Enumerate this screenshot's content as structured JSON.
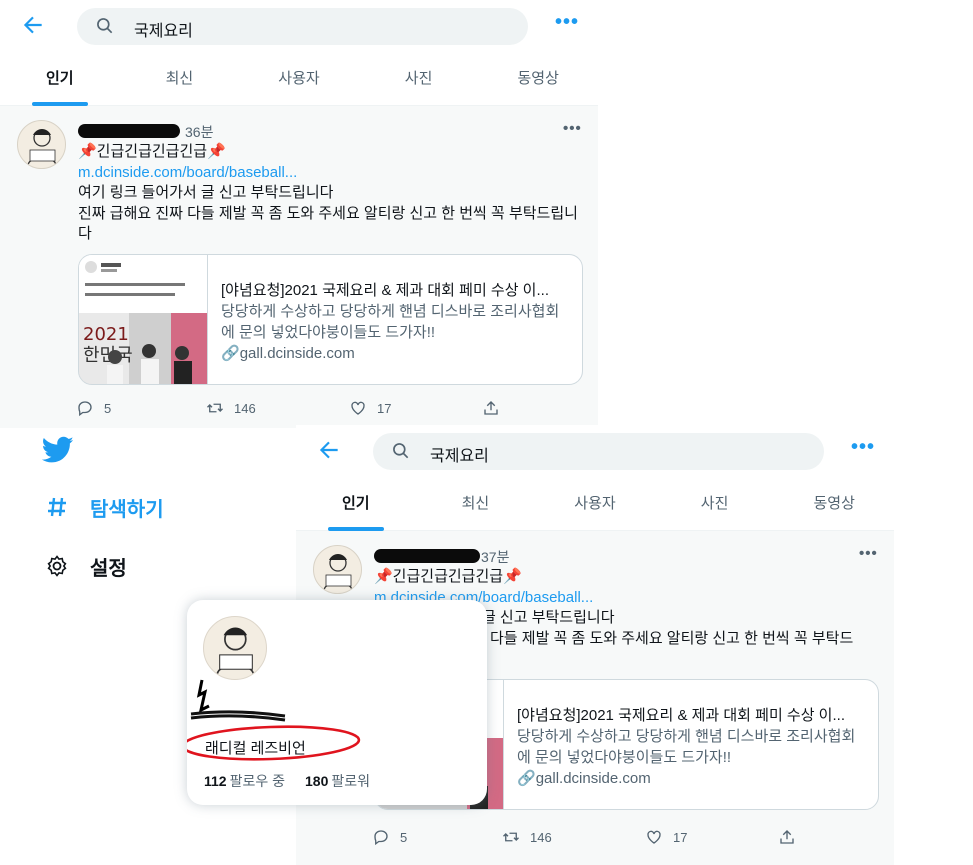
{
  "search": {
    "query": "국제요리"
  },
  "tabs": [
    "인기",
    "최신",
    "사용자",
    "사진",
    "동영상"
  ],
  "tweet_top": {
    "time": "36분",
    "title": "📌긴급긴급긴급긴급📌",
    "link": "m.dcinside.com/board/baseball...",
    "text1": "여기 링크 들어가서 글 신고 부탁드립니다",
    "text2": "진짜 급해요 진짜 다들 제발 꼭 좀 도와 주세요 알티랑 신고 한 번씩 꼭 부탁드립니다",
    "card_title": "[야념요청]2021 국제요리 & 제과 대회 페미 수상 이...",
    "card_desc": "당당하게 수상하고 당당하게 핸념 디스바로 조리사협회에 문의 넣었다야붕이들도 드가자!!",
    "card_domain": "gall.dcinside.com",
    "replies": "5",
    "retweets": "146",
    "likes": "17"
  },
  "tweet_bottom": {
    "time": "37분",
    "title": "📌긴급긴급긴급긴급📌",
    "link": "m.dcinside.com/board/baseball...",
    "text1": "서 글 신고 부탁드립니다",
    "text2": "다들 제발 꼭 좀 도와 주세요 알티랑 신고 한 번씩 꼭 부탁드",
    "card_title": "[야념요청]2021 국제요리 & 제과 대회 페미 수상 이...",
    "card_desc": "당당하게 수상하고 당당하게 핸념 디스바로 조리사협회에 문의 넣었다야붕이들도 드가자!!",
    "card_domain": "gall.dcinside.com",
    "replies": "5",
    "retweets": "146",
    "likes": "17"
  },
  "sidebar": {
    "explore": "탐색하기",
    "settings": "설정"
  },
  "hovercard": {
    "bio": "래디컬 레즈비언",
    "following_count": "112",
    "following_label": "팔로우 중",
    "followers_count": "180",
    "followers_label": "팔로워"
  },
  "colors": {
    "accent": "#1d9bf0",
    "annotation": "#e0141e"
  },
  "icons": [
    "back-arrow-icon",
    "search-icon",
    "more-icon",
    "reply-icon",
    "retweet-icon",
    "like-icon",
    "share-icon",
    "twitter-bird-icon",
    "hashtag-icon",
    "gear-icon",
    "link-icon"
  ]
}
